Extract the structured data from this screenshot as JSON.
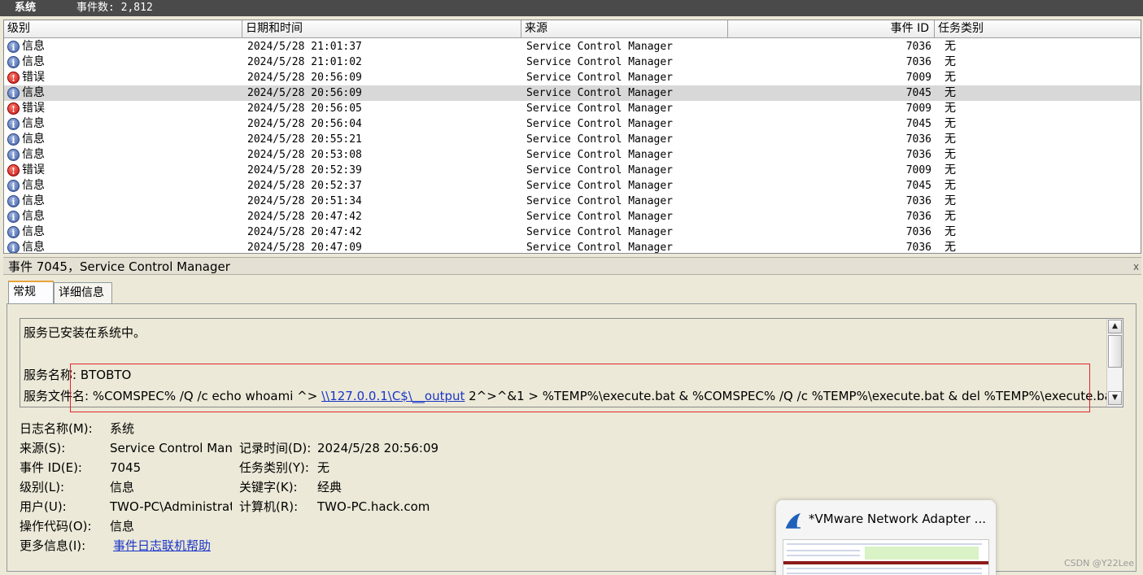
{
  "titlebar": {
    "name": "系统",
    "count": "事件数: 2,812"
  },
  "columns": {
    "level": "级别",
    "datetime": "日期和时间",
    "source": "来源",
    "event_id": "事件 ID",
    "task": "任务类别"
  },
  "rows": [
    {
      "level": "信息",
      "type": "info",
      "datetime": "2024/5/28 21:01:37",
      "source": "Service Control Manager",
      "event_id": "7036",
      "task": "无"
    },
    {
      "level": "信息",
      "type": "info",
      "datetime": "2024/5/28 21:01:02",
      "source": "Service Control Manager",
      "event_id": "7036",
      "task": "无"
    },
    {
      "level": "错误",
      "type": "error",
      "datetime": "2024/5/28 20:56:09",
      "source": "Service Control Manager",
      "event_id": "7009",
      "task": "无"
    },
    {
      "level": "信息",
      "type": "info",
      "datetime": "2024/5/28 20:56:09",
      "source": "Service Control Manager",
      "event_id": "7045",
      "task": "无"
    },
    {
      "level": "错误",
      "type": "error",
      "datetime": "2024/5/28 20:56:05",
      "source": "Service Control Manager",
      "event_id": "7009",
      "task": "无"
    },
    {
      "level": "信息",
      "type": "info",
      "datetime": "2024/5/28 20:56:04",
      "source": "Service Control Manager",
      "event_id": "7045",
      "task": "无"
    },
    {
      "level": "信息",
      "type": "info",
      "datetime": "2024/5/28 20:55:21",
      "source": "Service Control Manager",
      "event_id": "7036",
      "task": "无"
    },
    {
      "level": "信息",
      "type": "info",
      "datetime": "2024/5/28 20:53:08",
      "source": "Service Control Manager",
      "event_id": "7036",
      "task": "无"
    },
    {
      "level": "错误",
      "type": "error",
      "datetime": "2024/5/28 20:52:39",
      "source": "Service Control Manager",
      "event_id": "7009",
      "task": "无"
    },
    {
      "level": "信息",
      "type": "info",
      "datetime": "2024/5/28 20:52:37",
      "source": "Service Control Manager",
      "event_id": "7045",
      "task": "无"
    },
    {
      "level": "信息",
      "type": "info",
      "datetime": "2024/5/28 20:51:34",
      "source": "Service Control Manager",
      "event_id": "7036",
      "task": "无"
    },
    {
      "level": "信息",
      "type": "info",
      "datetime": "2024/5/28 20:47:42",
      "source": "Service Control Manager",
      "event_id": "7036",
      "task": "无"
    },
    {
      "level": "信息",
      "type": "info",
      "datetime": "2024/5/28 20:47:42",
      "source": "Service Control Manager",
      "event_id": "7036",
      "task": "无"
    },
    {
      "level": "信息",
      "type": "info",
      "datetime": "2024/5/28 20:47:09",
      "source": "Service Control Manager",
      "event_id": "7036",
      "task": "无"
    }
  ],
  "selected_row": 3,
  "detail": {
    "title": "事件 7045，Service Control Manager",
    "close": "x",
    "tabs": [
      "常规",
      "详细信息"
    ],
    "message_line1": "服务已安装在系统中。",
    "service_name_label": "服务名称:",
    "service_name": "BTOBTO",
    "service_file_label": "服务文件名:",
    "service_file_pre": "%COMSPEC% /Q /c echo whoami ^> ",
    "service_file_link": "\\\\127.0.0.1\\C$\\__output",
    "service_file_post": " 2^>^&1 > %TEMP%\\execute.bat & %COMSPEC% /Q /c %TEMP%\\execute.bat & del %TEMP%\\execute.bat",
    "properties": {
      "log_name_label": "日志名称(M):",
      "log_name": "系统",
      "source_label": "来源(S):",
      "source": "Service Control Man",
      "logged_label": "记录时间(D):",
      "logged": "2024/5/28 20:56:09",
      "event_id_label": "事件 ID(E):",
      "event_id": "7045",
      "task_label": "任务类别(Y):",
      "task": "无",
      "level_label": "级别(L):",
      "level": "信息",
      "keywords_label": "关键字(K):",
      "keywords": "经典",
      "user_label": "用户(U):",
      "user": "TWO-PC\\Administrat",
      "computer_label": "计算机(R):",
      "computer": "TWO-PC.hack.com",
      "opcode_label": "操作代码(O):",
      "opcode": "信息",
      "more_info_label": "更多信息(I):",
      "more_info_link": "事件日志联机帮助"
    }
  },
  "popup": {
    "title": "*VMware Network Adapter ..."
  },
  "watermark": "CSDN @Y22Lee",
  "colors": {
    "highlight_box": "#e0262a",
    "link": "#1a35c8",
    "selected_row": "#d8d8d8"
  }
}
